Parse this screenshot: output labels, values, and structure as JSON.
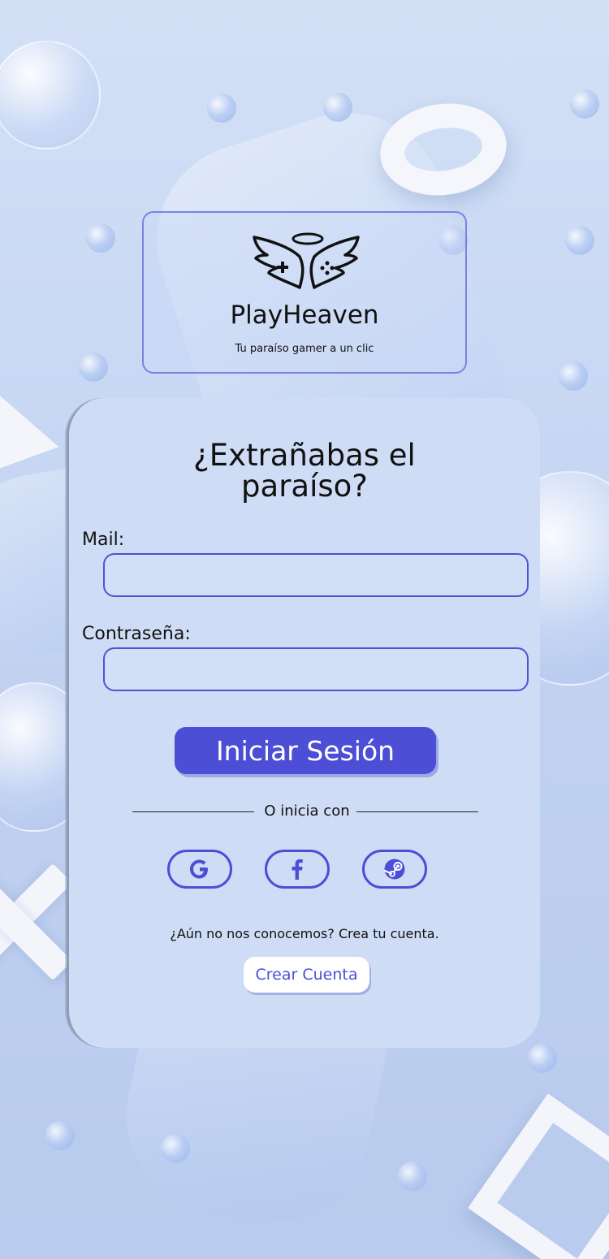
{
  "brand": {
    "name": "PlayHeaven",
    "tagline": "Tu paraíso gamer a un clic"
  },
  "login": {
    "title_line1": "¿Extrañabas el",
    "title_line2": "paraíso?",
    "mail_label": "Mail:",
    "mail_value": "",
    "password_label": "Contraseña:",
    "password_value": "",
    "submit_label": "Iniciar Sesión",
    "divider_text": "O inicia con",
    "social": [
      {
        "name": "google",
        "icon": "google-icon"
      },
      {
        "name": "facebook",
        "icon": "facebook-icon"
      },
      {
        "name": "steam",
        "icon": "steam-icon"
      }
    ],
    "signup_prompt": "¿Aún no nos conocemos? Crea tu cuenta.",
    "signup_button": "Crear Cuenta"
  },
  "colors": {
    "accent": "#4c4ed6",
    "card_background": "#cfdcf5",
    "page_background": "#c7d7f3"
  }
}
